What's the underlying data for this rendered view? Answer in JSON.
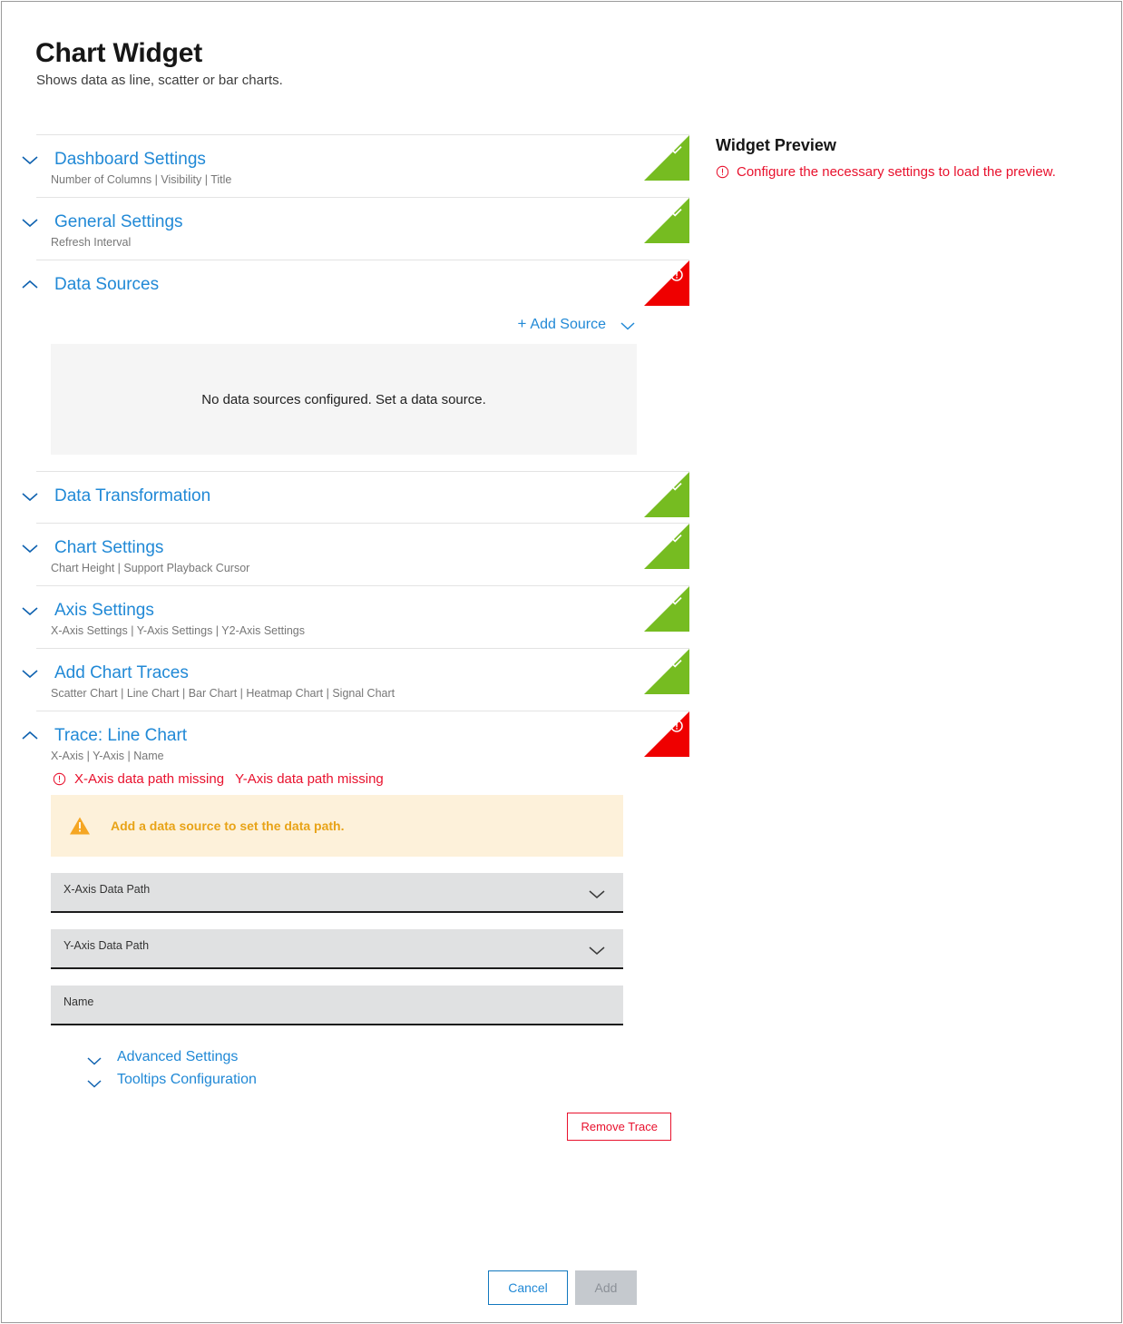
{
  "header": {
    "title": "Chart Widget",
    "subtitle": "Shows data as line, scatter or bar charts."
  },
  "sections": [
    {
      "id": "dashboard-settings",
      "title": "Dashboard Settings",
      "subtitle": "Number of Columns | Visibility | Title",
      "expanded": false,
      "chevron": "chevron-down-icon",
      "status": "valid",
      "status_icon": "check-icon",
      "status_color": "#76bc21"
    },
    {
      "id": "general-settings",
      "title": "General Settings",
      "subtitle": "Refresh Interval",
      "expanded": false,
      "chevron": "chevron-down-icon",
      "status": "valid",
      "status_icon": "check-icon",
      "status_color": "#76bc21"
    },
    {
      "id": "data-sources",
      "title": "Data Sources",
      "subtitle": "",
      "expanded": true,
      "chevron": "chevron-up-icon",
      "status": "error",
      "status_icon": "error-exclamation-icon",
      "status_color": "#ef0000"
    },
    {
      "id": "data-transformation",
      "title": "Data Transformation",
      "subtitle": "",
      "expanded": false,
      "chevron": "chevron-down-icon",
      "status": "valid",
      "status_icon": "check-icon",
      "status_color": "#76bc21"
    },
    {
      "id": "chart-settings",
      "title": "Chart Settings",
      "subtitle": "Chart Height | Support Playback Cursor",
      "expanded": false,
      "chevron": "chevron-down-icon",
      "status": "valid",
      "status_icon": "check-icon",
      "status_color": "#76bc21"
    },
    {
      "id": "axis-settings",
      "title": "Axis Settings",
      "subtitle": "X-Axis Settings | Y-Axis Settings | Y2-Axis Settings",
      "expanded": false,
      "chevron": "chevron-down-icon",
      "status": "valid",
      "status_icon": "check-icon",
      "status_color": "#76bc21"
    },
    {
      "id": "add-chart-traces",
      "title": "Add Chart Traces",
      "subtitle": "Scatter Chart | Line Chart | Bar Chart | Heatmap Chart | Signal Chart",
      "expanded": false,
      "chevron": "chevron-down-icon",
      "status": "valid",
      "status_icon": "check-icon",
      "status_color": "#76bc21"
    },
    {
      "id": "trace-line-chart",
      "title": "Trace: Line Chart",
      "subtitle": "X-Axis | Y-Axis | Name",
      "expanded": true,
      "chevron": "chevron-up-icon",
      "status": "error",
      "status_icon": "error-exclamation-icon",
      "status_color": "#ef0000"
    }
  ],
  "data_sources": {
    "add_source_label": "Add Source",
    "add_source_plus": "+",
    "add_source_chevron": "chevron-down-icon",
    "empty_message": "No data sources configured. Set a data source."
  },
  "trace": {
    "errors": [
      "X-Axis data path missing",
      "Y-Axis data path missing"
    ],
    "error_icon": "alert-circle-icon",
    "warning": {
      "icon": "warning-triangle-icon",
      "text": "Add a data source to set the data path.",
      "background": "#fdf1da",
      "text_color": "#e8a317"
    },
    "fields": [
      {
        "id": "x-axis-data-path",
        "label": "X-Axis Data Path",
        "value": "",
        "type": "select",
        "chevron": "chevron-down-icon"
      },
      {
        "id": "y-axis-data-path",
        "label": "Y-Axis Data Path",
        "value": "",
        "type": "select",
        "chevron": "chevron-down-icon"
      },
      {
        "id": "name",
        "label": "Name",
        "value": "",
        "type": "text",
        "chevron": ""
      }
    ],
    "sub_links": [
      {
        "id": "advanced-settings",
        "label": "Advanced Settings",
        "chevron": "chevron-down-icon"
      },
      {
        "id": "tooltips-configuration",
        "label": "Tooltips Configuration",
        "chevron": "chevron-down-icon"
      }
    ],
    "remove_label": "Remove Trace"
  },
  "preview": {
    "title": "Widget Preview",
    "message": "Configure the necessary settings to load the preview.",
    "message_icon": "alert-circle-icon",
    "message_color": "#e8112d"
  },
  "footer": {
    "cancel_label": "Cancel",
    "add_label": "Add",
    "add_disabled": true
  },
  "colors": {
    "link": "#2189d6",
    "valid": "#76bc21",
    "error": "#ef0000",
    "error_text": "#e8112d",
    "warning": "#e8a317"
  }
}
